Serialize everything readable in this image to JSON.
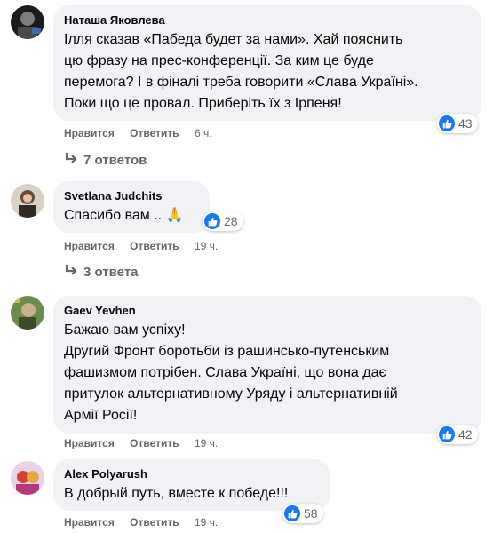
{
  "comments": [
    {
      "author": "Наташа Яковлева",
      "lines": [
        "Ілля сказав «Пабеда будет за нами». Хай пояснить",
        "цю фразу на прес-конференції. За ким це буде",
        "перемога? І в фіналі треба говорити «Слава Україні».",
        "Поки що це провал. Приберіть їх з Ірпеня!"
      ],
      "like_label": "Нравится",
      "reply_label": "Ответить",
      "time": "6 ч.",
      "reactions": "43",
      "replies": "7 ответов"
    },
    {
      "author": "Svetlana Judchits",
      "lines": [
        "Спасибо вам .. 🙏"
      ],
      "like_label": "Нравится",
      "reply_label": "Ответить",
      "time": "19 ч.",
      "reactions": "28",
      "replies": "3 ответа"
    },
    {
      "author": "Gaev Yevhen",
      "lines": [
        "Бажаю вам успіху!",
        "Другий Фронт боротьби із рашинсько-путенським",
        "фашизмом потрібен. Слава Україні, що вона дає",
        "притулок альтернативному Уряду і альтернативній",
        "Армії Росії!"
      ],
      "like_label": "Нравится",
      "reply_label": "Ответить",
      "time": "19 ч.",
      "reactions": "42"
    },
    {
      "author": "Alex Polyarush",
      "lines": [
        "В добрый путь, вместе к победе!!!"
      ],
      "like_label": "Нравится",
      "reply_label": "Ответить",
      "time": "19 ч.",
      "reactions": "58"
    }
  ],
  "colors": {
    "bubble": "#f0f2f5",
    "like_blue": "#1877f2",
    "meta_gray": "#65676b"
  },
  "icons": {
    "reaction": "thumbs-up-icon",
    "reply_arrow": "reply-arrow-icon"
  }
}
